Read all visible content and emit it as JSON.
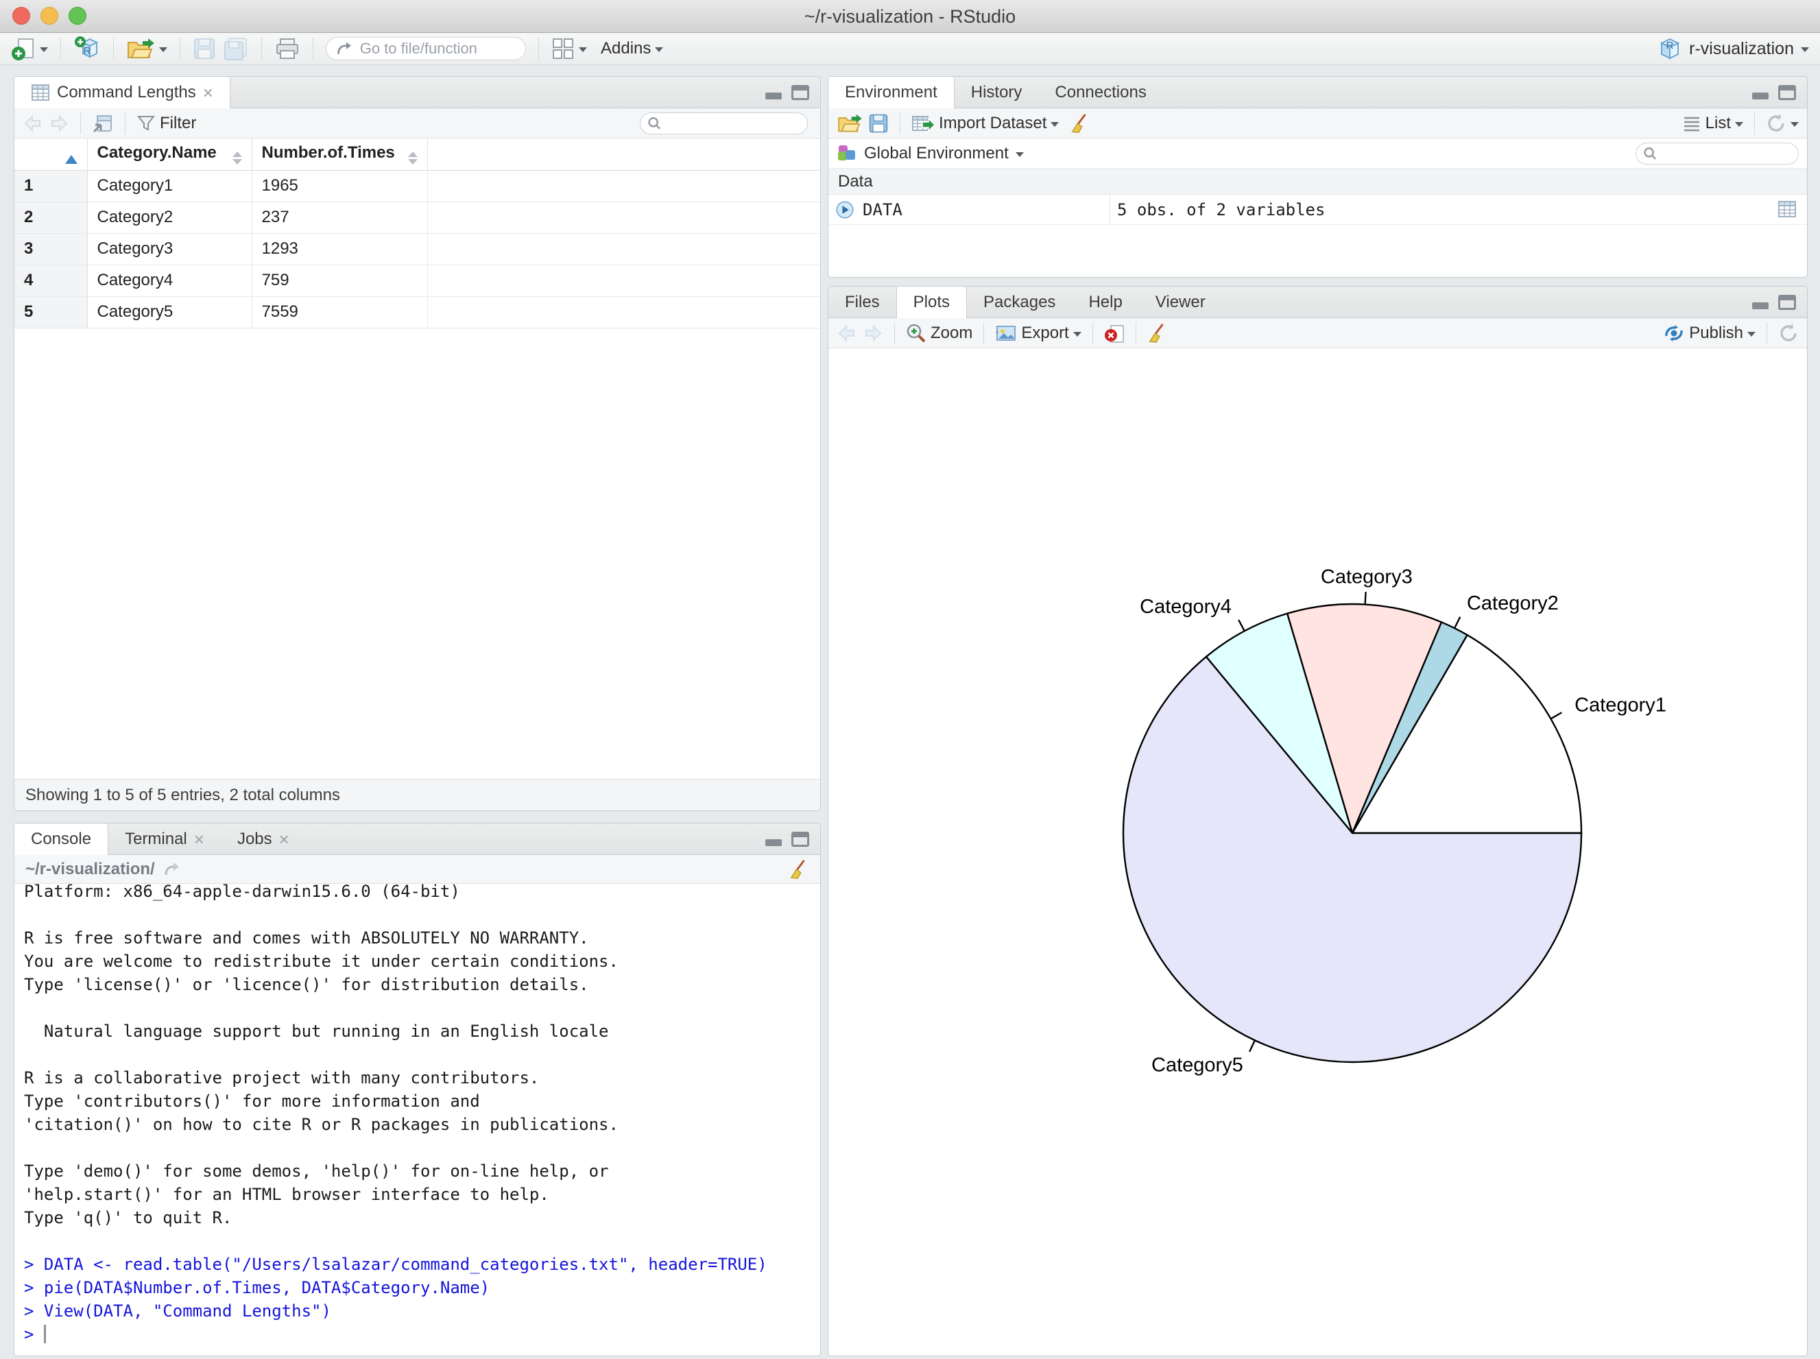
{
  "window": {
    "title": "~/r-visualization - RStudio"
  },
  "icons": {
    "r_letter": "R",
    "close_glyph": "×"
  },
  "colors": {
    "console_input": "#1414dc",
    "sort_active": "#3d85c6",
    "publish_blue": "#2f7fc1",
    "pie_stroke": "#000000"
  },
  "main_toolbar": {
    "goto_placeholder": "Go to file/function",
    "addins_label": "Addins",
    "project_label": "r-visualization"
  },
  "data_viewer": {
    "tab_title": "Command Lengths",
    "filter_label": "Filter",
    "status": "Showing 1 to 5 of 5 entries, 2 total columns",
    "table": {
      "columns": [
        "Category.Name",
        "Number.of.Times"
      ],
      "rows": [
        {
          "num": "1",
          "name": "Category1",
          "value": "1965"
        },
        {
          "num": "2",
          "name": "Category2",
          "value": "237"
        },
        {
          "num": "3",
          "name": "Category3",
          "value": "1293"
        },
        {
          "num": "4",
          "name": "Category4",
          "value": "759"
        },
        {
          "num": "5",
          "name": "Category5",
          "value": "7559"
        }
      ]
    }
  },
  "environment": {
    "tabs": [
      "Environment",
      "History",
      "Connections"
    ],
    "import_label": "Import Dataset",
    "list_label": "List",
    "scope_label": "Global Environment",
    "section_label": "Data",
    "objects": [
      {
        "name": "DATA",
        "value": "5 obs. of 2 variables"
      }
    ]
  },
  "plots": {
    "tabs": [
      "Files",
      "Plots",
      "Packages",
      "Help",
      "Viewer"
    ],
    "zoom_label": "Zoom",
    "export_label": "Export",
    "publish_label": "Publish"
  },
  "console": {
    "tabs": [
      "Console",
      "Terminal",
      "Jobs"
    ],
    "working_dir": "~/r-visualization/",
    "prompt": "> ",
    "lines": [
      {
        "type": "output",
        "text": "Platform: x86_64-apple-darwin15.6.0 (64-bit)"
      },
      {
        "type": "output",
        "text": ""
      },
      {
        "type": "output",
        "text": "R is free software and comes with ABSOLUTELY NO WARRANTY."
      },
      {
        "type": "output",
        "text": "You are welcome to redistribute it under certain conditions."
      },
      {
        "type": "output",
        "text": "Type 'license()' or 'licence()' for distribution details."
      },
      {
        "type": "output",
        "text": ""
      },
      {
        "type": "output",
        "text": "  Natural language support but running in an English locale"
      },
      {
        "type": "output",
        "text": ""
      },
      {
        "type": "output",
        "text": "R is a collaborative project with many contributors."
      },
      {
        "type": "output",
        "text": "Type 'contributors()' for more information and"
      },
      {
        "type": "output",
        "text": "'citation()' on how to cite R or R packages in publications."
      },
      {
        "type": "output",
        "text": ""
      },
      {
        "type": "output",
        "text": "Type 'demo()' for some demos, 'help()' for on-line help, or"
      },
      {
        "type": "output",
        "text": "'help.start()' for an HTML browser interface to help."
      },
      {
        "type": "output",
        "text": "Type 'q()' to quit R."
      },
      {
        "type": "output",
        "text": ""
      },
      {
        "type": "input",
        "text": "> DATA <- read.table(\"/Users/lsalazar/command_categories.txt\", header=TRUE)"
      },
      {
        "type": "input",
        "text": "> pie(DATA$Number.of.Times, DATA$Category.Name)"
      },
      {
        "type": "input",
        "text": "> View(DATA, \"Command Lengths\")"
      }
    ]
  },
  "chart_data": {
    "type": "pie",
    "title": "",
    "categories": [
      "Category1",
      "Category2",
      "Category3",
      "Category4",
      "Category5"
    ],
    "values": [
      1965,
      237,
      1293,
      759,
      7559
    ],
    "colors": [
      "#FFFFFF",
      "#ADD8E6",
      "#FFE4E1",
      "#E0FFFF",
      "#E6E6FA"
    ],
    "start_angle_deg": 0,
    "direction": "counterclockwise",
    "legend": false
  }
}
